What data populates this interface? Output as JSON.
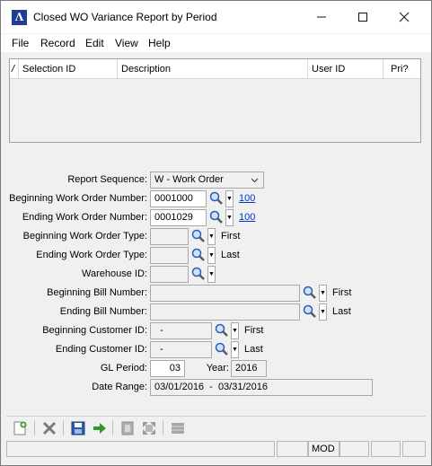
{
  "window": {
    "title": "Closed WO Variance Report by Period",
    "minimize_glyph": "—",
    "maximize_glyph": "☐",
    "close_glyph": "✕",
    "logo_glyph": "Λ"
  },
  "menu": {
    "file": "File",
    "record": "Record",
    "edit": "Edit",
    "view": "View",
    "help": "Help"
  },
  "grid": {
    "indicator": "/",
    "columns": {
      "selection_id": "Selection ID",
      "description": "Description",
      "user_id": "User ID",
      "pri": "Pri?"
    }
  },
  "form": {
    "report_sequence": {
      "label": "Report Sequence:",
      "value": "W - Work Order"
    },
    "beginning_work_order_number": {
      "label": "Beginning Work Order Number:",
      "value": "0001000",
      "link": "100"
    },
    "ending_work_order_number": {
      "label": "Ending Work Order Number:",
      "value": "0001029",
      "link": "100"
    },
    "beginning_work_order_type": {
      "label": "Beginning Work Order Type:",
      "value": "",
      "hint": "First"
    },
    "ending_work_order_type": {
      "label": "Ending Work Order Type:",
      "value": "",
      "hint": "Last"
    },
    "warehouse_id": {
      "label": "Warehouse ID:",
      "value": ""
    },
    "beginning_bill_number": {
      "label": "Beginning Bill Number:",
      "value": "",
      "hint": "First"
    },
    "ending_bill_number": {
      "label": "Ending Bill Number:",
      "value": "",
      "hint": "Last"
    },
    "beginning_customer_id": {
      "label": "Beginning Customer ID:",
      "value": "-",
      "hint": "First"
    },
    "ending_customer_id": {
      "label": "Ending Customer ID:",
      "value": "-",
      "hint": "Last"
    },
    "gl_period": {
      "label": "GL Period:",
      "value": "03"
    },
    "year": {
      "label": "Year:",
      "value": "2016"
    },
    "date_range": {
      "label": "Date Range:",
      "value": "03/01/2016  -  03/31/2016"
    }
  },
  "statusbar": {
    "mode": "MOD"
  },
  "colors": {
    "accent": "#1f3f94",
    "link": "#0033cc",
    "new_icon": "#4a9a2a",
    "delete_icon": "#7a7a7a",
    "save_icon": "#2a5db0",
    "next_icon": "#2e9a2e"
  },
  "icons": {
    "lookup": "magnifier-icon",
    "dropdown": "chevron-down-icon"
  }
}
